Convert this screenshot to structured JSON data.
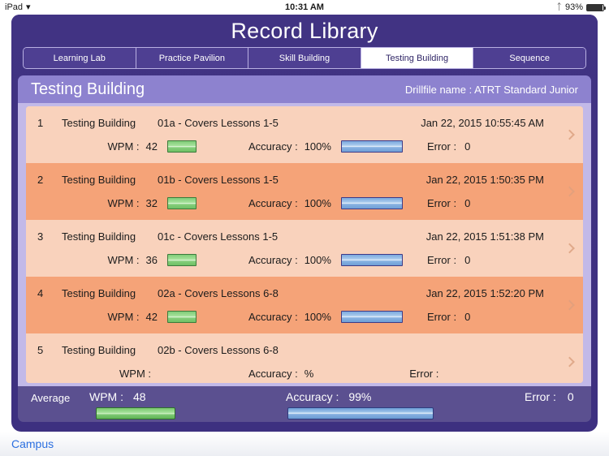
{
  "status_bar": {
    "carrier": "iPad",
    "wifi_icon": "wifi-icon",
    "time": "10:31 AM",
    "bluetooth_icon": "bluetooth-icon",
    "battery_percent": "93%",
    "battery_icon": "battery-icon"
  },
  "app": {
    "title": "Record Library",
    "accent_purple": "#413383",
    "band_purple": "#8d82cf",
    "row_light": "#f9d2bc",
    "row_dark": "#f5a378"
  },
  "tabs": [
    {
      "label": "Learning Lab",
      "active": false
    },
    {
      "label": "Practice Pavilion",
      "active": false
    },
    {
      "label": "Skill Building",
      "active": false
    },
    {
      "label": "Testing Building",
      "active": true
    },
    {
      "label": "Sequence",
      "active": false
    }
  ],
  "subheader": {
    "section_title": "Testing Building",
    "drillfile": "Drillfile name : ATRT Standard Junior"
  },
  "labels": {
    "wpm": "WPM :",
    "accuracy": "Accuracy :",
    "error": "Error :",
    "average": "Average"
  },
  "records": [
    {
      "index": "1",
      "name": "Testing Building",
      "drill": "01a - Covers Lessons 1-5",
      "date": "Jan 22, 2015  10:55:45 AM",
      "wpm": "42",
      "accuracy": "100%",
      "error": "0",
      "wpm_bar_pct": 100,
      "acc_bar_pct": 100,
      "chevron_icon": "chevron-right-icon"
    },
    {
      "index": "2",
      "name": "Testing Building",
      "drill": "01b - Covers Lessons 1-5",
      "date": "Jan 22, 2015  1:50:35 PM",
      "wpm": "32",
      "accuracy": "100%",
      "error": "0",
      "wpm_bar_pct": 100,
      "acc_bar_pct": 100,
      "chevron_icon": "chevron-right-icon"
    },
    {
      "index": "3",
      "name": "Testing Building",
      "drill": "01c - Covers Lessons 1-5",
      "date": "Jan 22, 2015  1:51:38 PM",
      "wpm": "36",
      "accuracy": "100%",
      "error": "0",
      "wpm_bar_pct": 100,
      "acc_bar_pct": 100,
      "chevron_icon": "chevron-right-icon"
    },
    {
      "index": "4",
      "name": "Testing Building",
      "drill": "02a - Covers Lessons 6-8",
      "date": "Jan 22, 2015  1:52:20 PM",
      "wpm": "42",
      "accuracy": "100%",
      "error": "0",
      "wpm_bar_pct": 100,
      "acc_bar_pct": 100,
      "chevron_icon": "chevron-right-icon"
    },
    {
      "index": "5",
      "name": "Testing Building",
      "drill": "02b - Covers Lessons 6-8",
      "date": "",
      "wpm": "",
      "accuracy": "",
      "error": "",
      "wpm_bar_pct": 0,
      "acc_bar_pct": 0,
      "chevron_icon": "chevron-right-icon"
    }
  ],
  "average": {
    "label": "Average",
    "wpm_label": "WPM :",
    "wpm_value": "48",
    "accuracy_label": "Accuracy :",
    "accuracy_value": "99%",
    "error_label": "Error :",
    "error_value": "0"
  },
  "bottom_bar": {
    "campus_link": "Campus"
  }
}
